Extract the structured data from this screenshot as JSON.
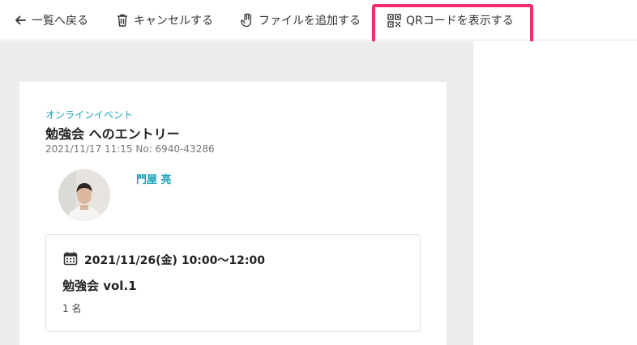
{
  "toolbar": {
    "back_label": "一覧へ戻る",
    "cancel_label": "キャンセルする",
    "add_file_label": "ファイルを追加する",
    "show_qr_label": "QRコードを表示する",
    "highlight_color": "#ee2d72"
  },
  "entry": {
    "category": "オンラインイベント",
    "title": "勉強会 へのエントリー",
    "meta": "2021/11/17 11:15 No: 6940-43286",
    "accent_color": "#1aa0b8"
  },
  "person": {
    "name": "門屋 亮"
  },
  "event": {
    "datetime": "2021/11/26(金) 10:00〜12:00",
    "name": "勉強会 vol.1",
    "count": "1 名"
  }
}
